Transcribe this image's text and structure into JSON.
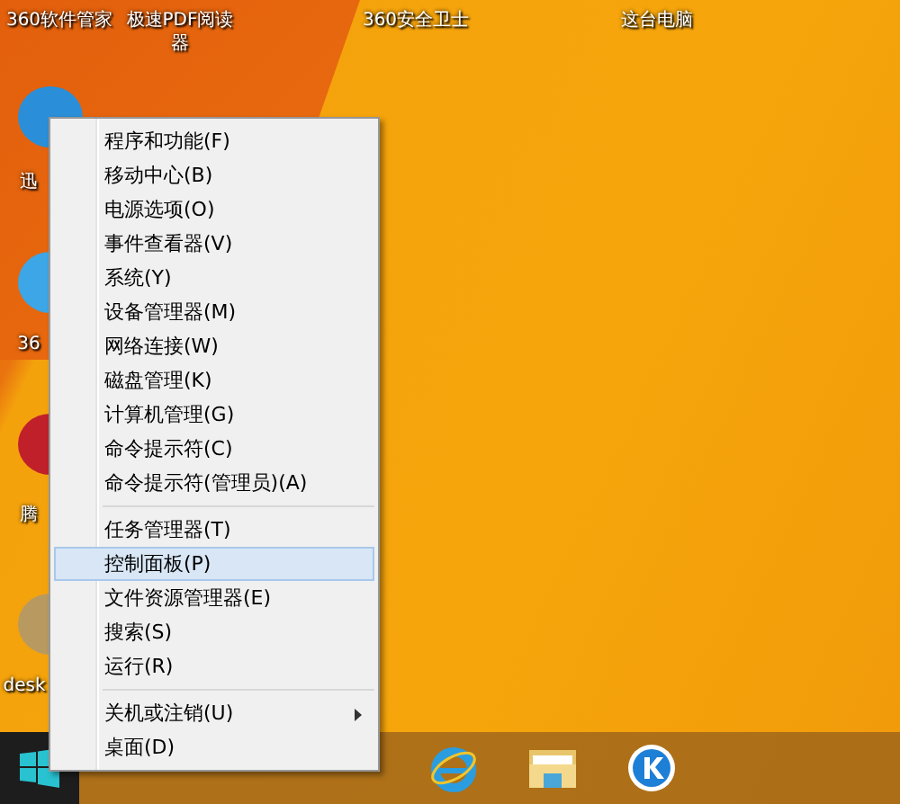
{
  "desktop_icons": [
    {
      "label": "360软件管家"
    },
    {
      "label": "极速PDF阅读器"
    },
    {
      "label": "360安全卫士"
    },
    {
      "label": "这台电脑"
    },
    {
      "label": "迅"
    },
    {
      "label": "36"
    },
    {
      "label": "腾"
    },
    {
      "label": "desk"
    }
  ],
  "context_menu": {
    "groups": [
      {
        "items": [
          {
            "label": "程序和功能(F)",
            "selected": false
          },
          {
            "label": "移动中心(B)",
            "selected": false
          },
          {
            "label": "电源选项(O)",
            "selected": false
          },
          {
            "label": "事件查看器(V)",
            "selected": false
          },
          {
            "label": "系统(Y)",
            "selected": false
          },
          {
            "label": "设备管理器(M)",
            "selected": false
          },
          {
            "label": "网络连接(W)",
            "selected": false
          },
          {
            "label": "磁盘管理(K)",
            "selected": false
          },
          {
            "label": "计算机管理(G)",
            "selected": false
          },
          {
            "label": "命令提示符(C)",
            "selected": false
          },
          {
            "label": "命令提示符(管理员)(A)",
            "selected": false
          }
        ]
      },
      {
        "items": [
          {
            "label": "任务管理器(T)",
            "selected": false
          },
          {
            "label": "控制面板(P)",
            "selected": true
          },
          {
            "label": "文件资源管理器(E)",
            "selected": false
          },
          {
            "label": "搜索(S)",
            "selected": false
          },
          {
            "label": "运行(R)",
            "selected": false
          }
        ]
      },
      {
        "items": [
          {
            "label": "关机或注销(U)",
            "selected": false,
            "submenu": true
          },
          {
            "label": "桌面(D)",
            "selected": false
          }
        ]
      }
    ]
  }
}
